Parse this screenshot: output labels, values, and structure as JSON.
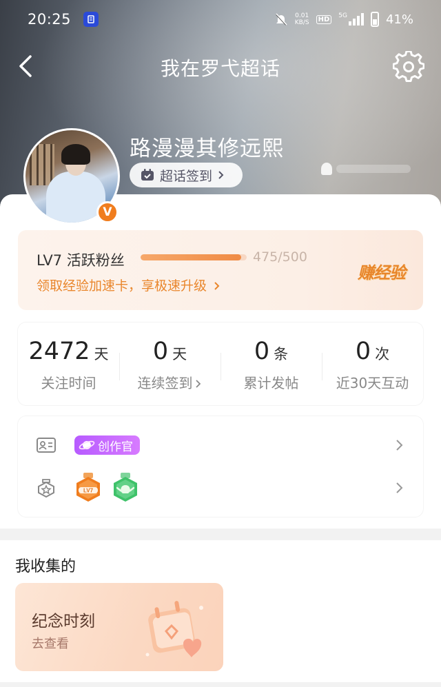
{
  "status_bar": {
    "time": "20:25",
    "net_speed_value": "0.01",
    "net_speed_unit": "KB/S",
    "hd_label": "HD",
    "network_type": "5G",
    "battery": "41%"
  },
  "nav": {
    "title": "我在罗弋超话"
  },
  "profile": {
    "name": "路漫漫其修远熙",
    "checkin_label": "超话签到",
    "verified_mark": "V"
  },
  "level": {
    "title": "LV7 活跃粉丝",
    "progress_text": "475/500",
    "progress_fraction": 0.95,
    "tip": "领取经验加速卡，享极速升级",
    "earn_label": "赚经验"
  },
  "stats": [
    {
      "number": "2472",
      "unit": "天",
      "label": "关注时间"
    },
    {
      "number": "0",
      "unit": "天",
      "label": "连续签到"
    },
    {
      "number": "0",
      "unit": "条",
      "label": "累计发帖"
    },
    {
      "number": "0",
      "unit": "次",
      "label": "近30天互动"
    }
  ],
  "badges": {
    "creator_tag": "创作官",
    "level_badge_text": "LV7"
  },
  "collection": {
    "title": "我收集的",
    "moment_title": "纪念时刻",
    "moment_sub": "去查看"
  },
  "colors": {
    "accent_orange": "#f08b45",
    "creator_purple": "#c06bff",
    "level_badge_orange": "#f07d1e",
    "level_badge_green": "#3fc26a"
  },
  "icons": {
    "back": "chevron-left-icon",
    "settings": "gear-icon",
    "checkin": "calendar-check-icon",
    "id_card": "id-card-icon",
    "medal": "medal-icon"
  }
}
